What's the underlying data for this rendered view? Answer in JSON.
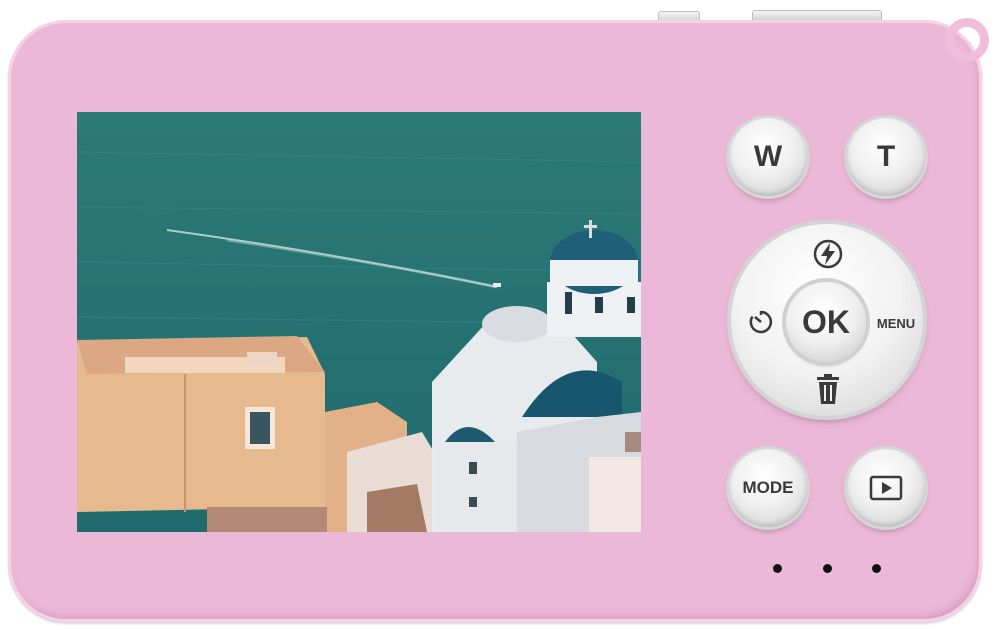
{
  "camera": {
    "zoom_wide_label": "W",
    "zoom_tele_label": "T",
    "ok_label": "OK",
    "menu_label": "MENU",
    "mode_label": "MODE",
    "body_color": "#ecb8d8",
    "icons": {
      "flash": "flash-icon",
      "self_timer": "self-timer-icon",
      "delete": "trash-icon",
      "playback": "playback-icon"
    }
  }
}
